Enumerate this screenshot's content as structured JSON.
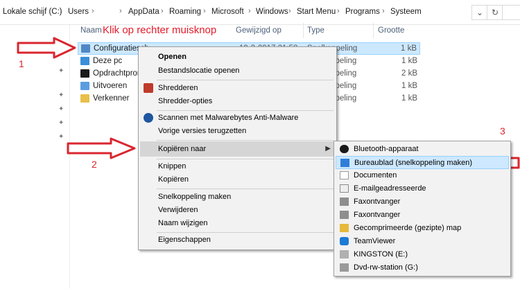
{
  "address": {
    "crumbs": [
      "Lokale schijf (C:)",
      "Users",
      "",
      "AppData",
      "Roaming",
      "Microsoft",
      "Windows",
      "Start Menu",
      "Programs",
      "Systeem"
    ],
    "dropdown_icon": "chevron-down-icon",
    "refresh_icon": "refresh-icon"
  },
  "columns": {
    "name": "Naam",
    "modified": "Gewijzigd op",
    "type": "Type",
    "size": "Grootte"
  },
  "files": [
    {
      "name": "Configuratiesch",
      "date": "19-3-2017 21:58",
      "type": "Snelkoppeling",
      "size": "1 kB",
      "selected": true
    },
    {
      "name": "Deze pc",
      "type": "Snelkoppeling",
      "size": "1 kB"
    },
    {
      "name": "Opdrachtprom",
      "type": "Snelkoppeling",
      "size": "2 kB"
    },
    {
      "name": "Uitvoeren",
      "type": "Snelkoppeling",
      "size": "1 kB"
    },
    {
      "name": "Verkenner",
      "type": "Snelkoppeling",
      "size": "1 kB"
    }
  ],
  "annotations": {
    "title": "Klik op rechter muisknop",
    "n1": "1",
    "n2": "2",
    "n3": "3",
    "color": "#d9262f"
  },
  "context_menu": {
    "open": "Openen",
    "open_location": "Bestandslocatie openen",
    "shred": "Shredderen",
    "shred_options": "Shredder-opties",
    "malwarebytes": "Scannen met Malwarebytes Anti-Malware",
    "restore": "Vorige versies terugzetten",
    "send_to": "Kopiëren naar",
    "cut": "Knippen",
    "copy": "Kopiëren",
    "shortcut": "Snelkoppeling maken",
    "delete": "Verwijderen",
    "rename": "Naam wijzigen",
    "properties": "Eigenschappen"
  },
  "submenu": [
    {
      "label": "Bluetooth-apparaat",
      "icon": "bluetooth-icon"
    },
    {
      "label": "Bureaublad (snelkoppeling maken)",
      "icon": "desktop-icon",
      "highlighted": true
    },
    {
      "label": "Documenten",
      "icon": "documents-icon"
    },
    {
      "label": "E-mailgeadresseerde",
      "icon": "mail-icon"
    },
    {
      "label": "Faxontvanger",
      "icon": "fax-icon"
    },
    {
      "label": "Faxontvanger",
      "icon": "fax-icon"
    },
    {
      "label": "Gecomprimeerde (gezipte) map",
      "icon": "zip-folder-icon"
    },
    {
      "label": "TeamViewer",
      "icon": "teamviewer-icon"
    },
    {
      "label": "KINGSTON (E:)",
      "icon": "usb-drive-icon"
    },
    {
      "label": "Dvd-rw-station (G:)",
      "icon": "dvd-drive-icon"
    }
  ]
}
